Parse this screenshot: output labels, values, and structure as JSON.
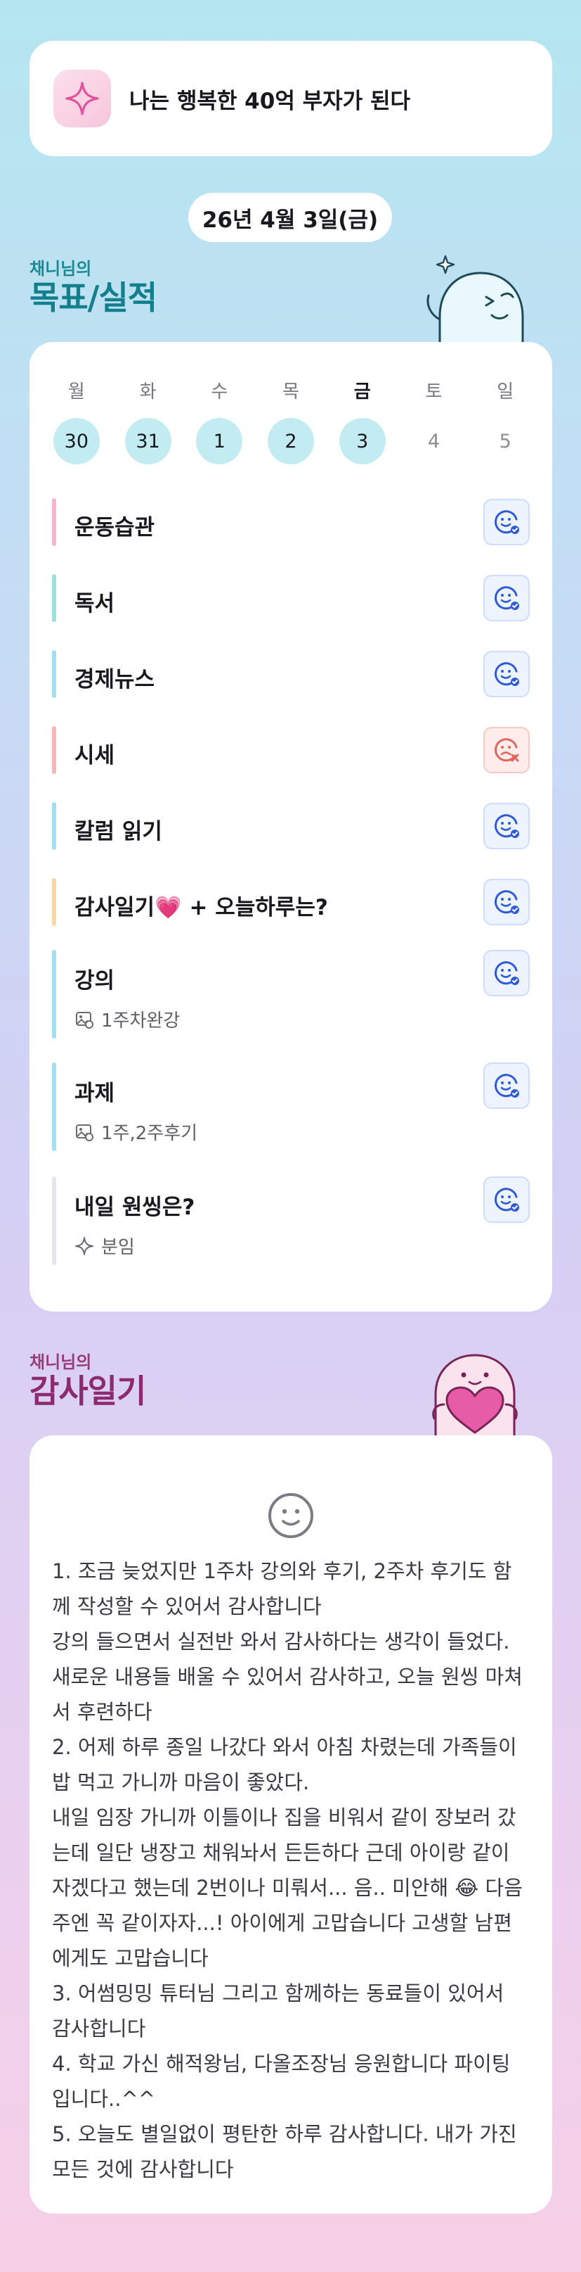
{
  "goal": {
    "text": "나는 행복한 40억 부자가 된다",
    "icon": "sparkle-icon"
  },
  "date_label": "26년 4월 3일(금)",
  "goals_section": {
    "subtitle": "채니님의",
    "title": "목표/실적"
  },
  "week": {
    "days": [
      {
        "name": "월",
        "num": "30",
        "state": "filled"
      },
      {
        "name": "화",
        "num": "31",
        "state": "filled"
      },
      {
        "name": "수",
        "num": "1",
        "state": "filled"
      },
      {
        "name": "목",
        "num": "2",
        "state": "filled"
      },
      {
        "name": "금",
        "num": "3",
        "state": "today"
      },
      {
        "name": "토",
        "num": "4",
        "state": "empty"
      },
      {
        "name": "일",
        "num": "5",
        "state": "empty"
      }
    ]
  },
  "habits": [
    {
      "title": "운동습관",
      "status": "done",
      "bar_color": "#f6b5cf"
    },
    {
      "title": "독서",
      "status": "done",
      "bar_color": "#9fe0dc"
    },
    {
      "title": "경제뉴스",
      "status": "done",
      "bar_color": "#a6def0"
    },
    {
      "title": "시세",
      "status": "failed",
      "bar_color": "#f7b7b7"
    },
    {
      "title": "칼럼 읽기",
      "status": "done",
      "bar_color": "#a6def0"
    },
    {
      "title": "감사일기💗 + 오늘하루는?",
      "status": "done",
      "bar_color": "#f8d6a5"
    },
    {
      "title": "강의",
      "status": "done",
      "bar_color": "#a6def0",
      "note": "1주차완강",
      "note_icon": "photo-icon"
    },
    {
      "title": "과제",
      "status": "done",
      "bar_color": "#a6def0",
      "note": "1주,2주후기",
      "note_icon": "photo-icon"
    },
    {
      "title": "내일 원씽은?",
      "status": "done",
      "bar_color": "#e6e6ea",
      "note": "분임",
      "note_icon": "sparkle-icon"
    }
  ],
  "gratitude_section": {
    "subtitle": "채니님의",
    "title": "감사일기"
  },
  "diary": {
    "mood_icon": "smile-icon",
    "text": "1. 조금 늦었지만 1주차 강의와 후기, 2주차 후기도 함께 작성할 수 있어서 감사합니다\n강의 들으면서 실전반 와서 감사하다는 생각이 들었다. 새로운 내용들 배울 수 있어서 감사하고, 오늘 원씽 마쳐서 후련하다\n2. 어제 하루 종일 나갔다 와서 아침 차렸는데 가족들이 밥 먹고 가니까 마음이 좋았다.\n내일 임장 가니까 이틀이나 집을 비워서 같이 장보러 갔는데 일단 냉장고 채워놔서 든든하다 근데 아이랑 같이 자겠다고 했는데 2번이나 미뤄서... 음.. 미안해 😂 다음주엔 꼭 같이자자...! 아이에게 고맙습니다 고생할 남편에게도 고맙습니다\n3. 어썸밍밍 튜터님 그리고 함께하는 동료들이 있어서 감사합니다\n4. 학교 가신 해적왕님, 다올조장님 응원합니다 파이팅입니다..^^\n5. 오늘도 별일없이 평탄한 하루 감사합니다. 내가 가진 모든 것에 감사합니다"
  },
  "colors": {
    "accent_teal": "#137e8c",
    "accent_plum": "#8b2a6e",
    "status_ok": "#2f5bd6",
    "status_fail": "#e0675c"
  }
}
